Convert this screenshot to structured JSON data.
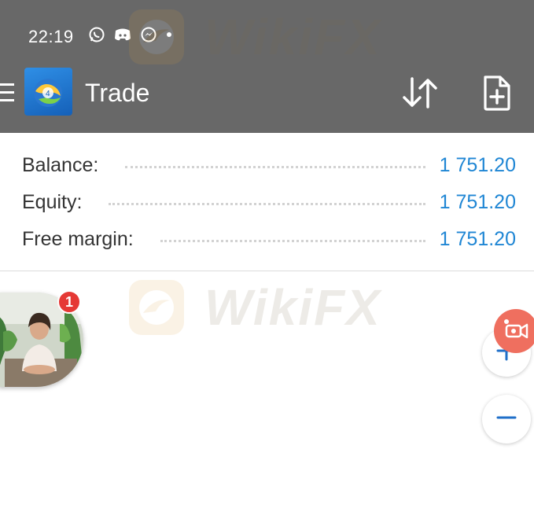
{
  "status_bar": {
    "time": "22:19",
    "icons": [
      "whatsapp-icon",
      "discord-icon",
      "messenger-icon",
      "notification-dot-icon"
    ]
  },
  "toolbar": {
    "title": "Trade",
    "menu_icon": "hamburger-menu-icon",
    "app_icon": "metatrader-logo-icon",
    "sort_icon": "sort-arrows-icon",
    "new_order_icon": "new-order-document-icon"
  },
  "account": {
    "rows": [
      {
        "label": "Balance:",
        "value": "1 751.20"
      },
      {
        "label": "Equity:",
        "value": "1 751.20"
      },
      {
        "label": "Free margin:",
        "value": "1 751.20"
      }
    ]
  },
  "chat_head": {
    "badge_count": "1"
  },
  "controls": {
    "zoom_in_icon": "plus-icon",
    "zoom_out_icon": "minus-icon",
    "record_icon": "screen-record-icon"
  },
  "watermark": {
    "text": "WikiFX"
  },
  "colors": {
    "header_bg": "#686868",
    "value_blue": "#1f86d4",
    "badge_red": "#e53935",
    "record_red": "#ef6f5f"
  }
}
